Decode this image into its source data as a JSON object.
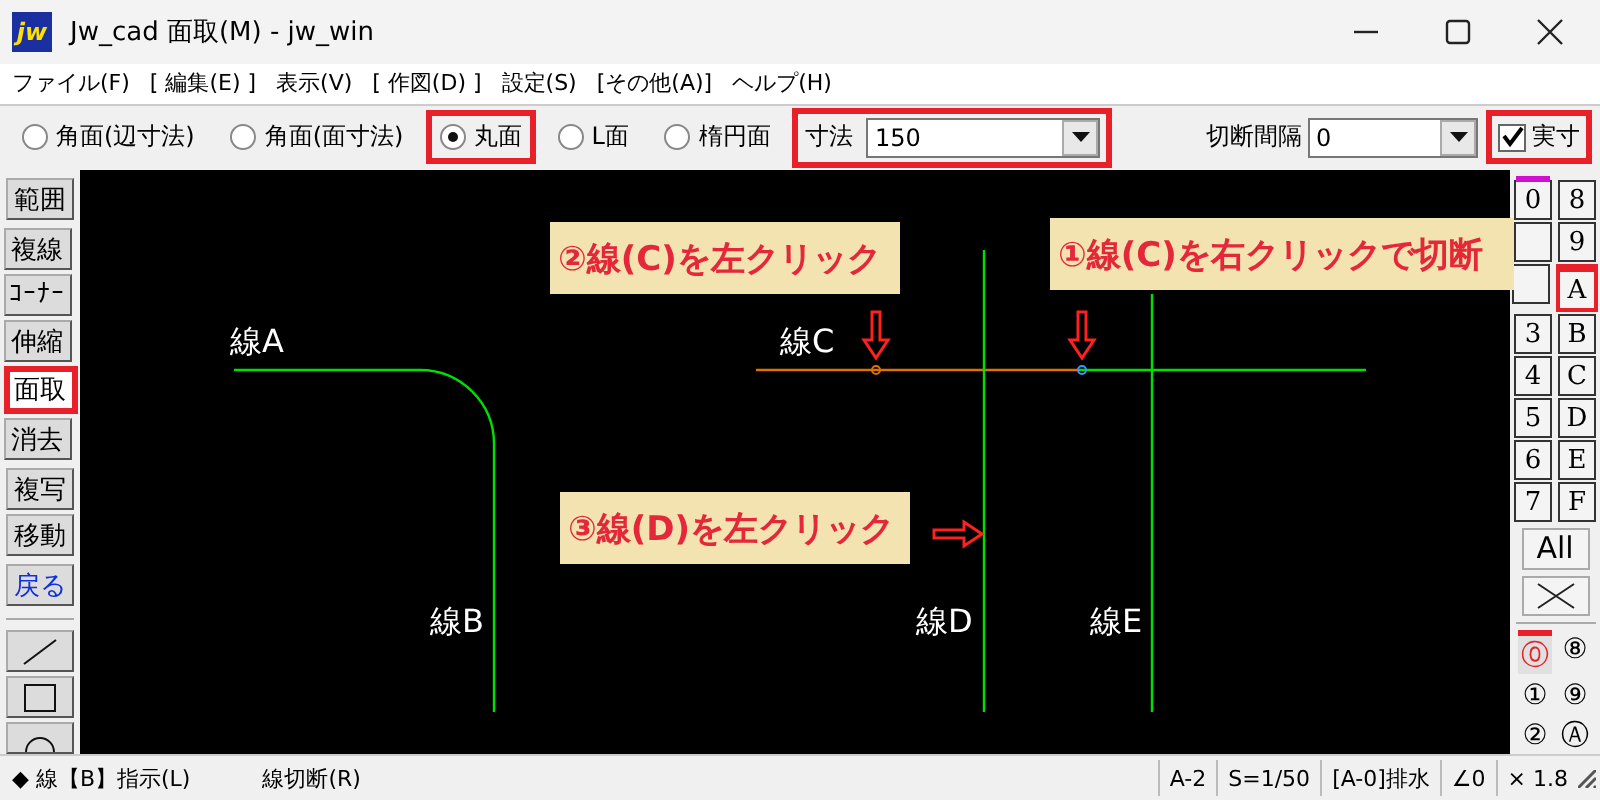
{
  "window": {
    "logo_text": "jw",
    "title": "Jw_cad 面取(M) - jw_win"
  },
  "menu": [
    "ファイル(F)",
    "[ 編集(E) ]",
    "表示(V)",
    "[ 作図(D) ]",
    "設定(S)",
    "[その他(A)]",
    "ヘルプ(H)"
  ],
  "toolbar": {
    "options": [
      {
        "label": "角面(辺寸法)",
        "selected": false,
        "highlighted": false
      },
      {
        "label": "角面(面寸法)",
        "selected": false,
        "highlighted": false
      },
      {
        "label": "丸面",
        "selected": true,
        "highlighted": true
      },
      {
        "label": "L面",
        "selected": false,
        "highlighted": false
      },
      {
        "label": "楕円面",
        "selected": false,
        "highlighted": false
      }
    ],
    "size": {
      "label": "寸法",
      "value": "150",
      "highlighted": true
    },
    "gap": {
      "label": "切断間隔",
      "value": "0"
    },
    "actual": {
      "label": "実寸",
      "checked": true,
      "highlighted": true
    }
  },
  "tool_groups": [
    [
      {
        "label": "範囲",
        "selected": false,
        "highlighted": false,
        "kind": "text"
      }
    ],
    [
      {
        "label": "複線",
        "selected": false,
        "highlighted": false,
        "kind": "text"
      },
      {
        "label": "ｺｰﾅｰ",
        "selected": false,
        "highlighted": false,
        "kind": "text"
      },
      {
        "label": "伸縮",
        "selected": false,
        "highlighted": false,
        "kind": "text"
      },
      {
        "label": "面取",
        "selected": true,
        "highlighted": true,
        "kind": "text"
      },
      {
        "label": "消去",
        "selected": false,
        "highlighted": false,
        "kind": "text"
      }
    ],
    [
      {
        "label": "複写",
        "selected": false,
        "highlighted": false,
        "kind": "text"
      },
      {
        "label": "移動",
        "selected": false,
        "highlighted": false,
        "kind": "text"
      }
    ],
    [
      {
        "label": "戻る",
        "selected": false,
        "highlighted": false,
        "kind": "undo"
      }
    ],
    [
      {
        "kind": "line"
      },
      {
        "kind": "rect"
      },
      {
        "kind": "circle"
      }
    ]
  ],
  "canvas": {
    "labels": [
      "線A",
      "線B",
      "線C",
      "線D",
      "線E"
    ],
    "callouts": [
      "②線(C)を左クリック",
      "①線(C)を右クリックで切断",
      "③線(D)を左クリック"
    ]
  },
  "layer_groups": [
    {
      "left": {
        "label": "0",
        "selected": false,
        "in_use": true
      },
      "right": {
        "label": "8",
        "selected": false,
        "in_use": false
      }
    },
    {
      "right": {
        "label": "9",
        "selected": false,
        "in_use": false
      }
    },
    {
      "right": {
        "label": "A",
        "selected": true,
        "in_use": false
      }
    },
    {
      "left": {
        "label": "3",
        "selected": false,
        "in_use": false
      },
      "right": {
        "label": "B",
        "selected": false,
        "in_use": false
      }
    },
    {
      "left": {
        "label": "4",
        "selected": false,
        "in_use": false
      },
      "right": {
        "label": "C",
        "selected": false,
        "in_use": false
      }
    },
    {
      "left": {
        "label": "5",
        "selected": false,
        "in_use": false
      },
      "right": {
        "label": "D",
        "selected": false,
        "in_use": false
      }
    },
    {
      "left": {
        "label": "6",
        "selected": false,
        "in_use": false
      },
      "right": {
        "label": "E",
        "selected": false,
        "in_use": false
      }
    },
    {
      "left": {
        "label": "7",
        "selected": false,
        "in_use": false
      },
      "right": {
        "label": "F",
        "selected": false,
        "in_use": false
      }
    }
  ],
  "all_button": "All",
  "layers": [
    {
      "left": {
        "label": "⓪",
        "selected": true
      },
      "right": {
        "label": "⑧",
        "selected": false
      }
    },
    {
      "left": {
        "label": "①",
        "selected": false
      },
      "right": {
        "label": "⑨",
        "selected": false
      }
    },
    {
      "left": {
        "label": "②",
        "selected": false
      },
      "right": {
        "label": "Ⓐ",
        "selected": false
      }
    }
  ],
  "status_bar": {
    "left": [
      "◆ 線【B】指示(L)",
      "線切断(R)"
    ],
    "cells": [
      "A-2",
      "S=1/50",
      "[A-0]排水",
      "∠0",
      "× 1.8"
    ]
  }
}
